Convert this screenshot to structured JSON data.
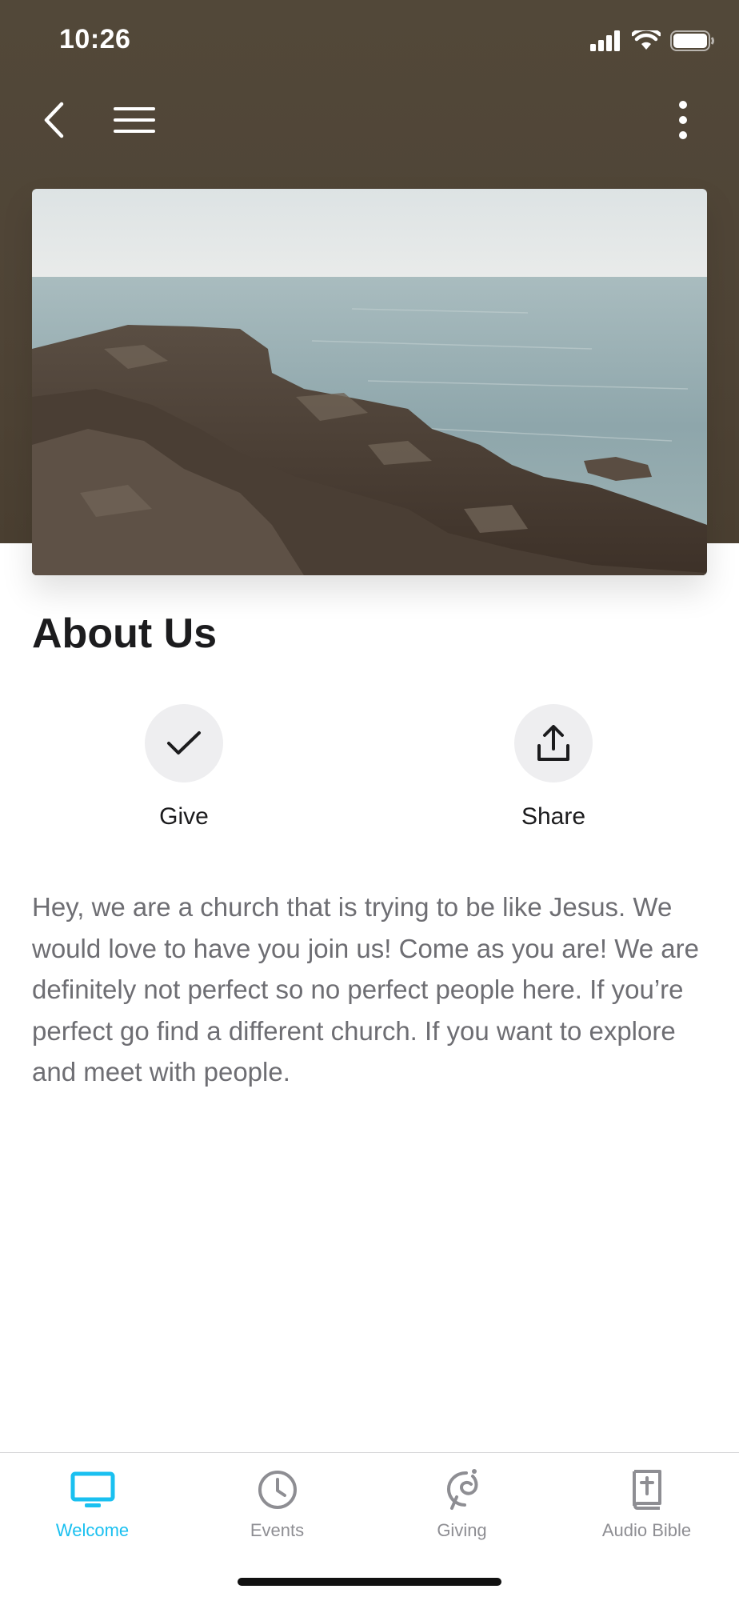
{
  "status_bar": {
    "time": "10:26"
  },
  "nav": {
    "back_icon": "chevron-left-icon",
    "menu_icon": "hamburger-menu-icon",
    "more_icon": "more-vertical-icon"
  },
  "hero": {
    "icon": "coastal-rocks-photo"
  },
  "page": {
    "title": "About Us"
  },
  "actions": [
    {
      "label": "Give",
      "icon": "checkmark-icon"
    },
    {
      "label": "Share",
      "icon": "share-upload-icon"
    }
  ],
  "description": "Hey, we are a church that is trying to be like Jesus. We would love to have you join us! Come as you are! We are definitely not perfect so no perfect people here. If you’re perfect go find a different church. If you want to explore and meet with people.",
  "tabs": [
    {
      "label": "Welcome",
      "icon": "monitor-icon",
      "active": true
    },
    {
      "label": "Events",
      "icon": "clock-icon",
      "active": false
    },
    {
      "label": "Giving",
      "icon": "giving-icon",
      "active": false
    },
    {
      "label": "Audio Bible",
      "icon": "bible-icon",
      "active": false
    }
  ],
  "colors": {
    "header_bg": "#4f4436",
    "accent": "#1ac0f0",
    "inactive_tab": "#8e8e93",
    "body_text": "#6e6e73"
  }
}
